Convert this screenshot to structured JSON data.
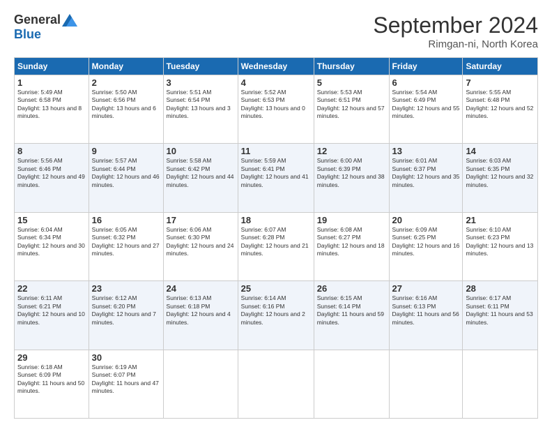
{
  "logo": {
    "general": "General",
    "blue": "Blue"
  },
  "title": "September 2024",
  "location": "Rimgan-ni, North Korea",
  "days_header": [
    "Sunday",
    "Monday",
    "Tuesday",
    "Wednesday",
    "Thursday",
    "Friday",
    "Saturday"
  ],
  "weeks": [
    [
      {
        "day": "1",
        "sunrise": "5:49 AM",
        "sunset": "6:58 PM",
        "daylight": "13 hours and 8 minutes."
      },
      {
        "day": "2",
        "sunrise": "5:50 AM",
        "sunset": "6:56 PM",
        "daylight": "13 hours and 6 minutes."
      },
      {
        "day": "3",
        "sunrise": "5:51 AM",
        "sunset": "6:54 PM",
        "daylight": "13 hours and 3 minutes."
      },
      {
        "day": "4",
        "sunrise": "5:52 AM",
        "sunset": "6:53 PM",
        "daylight": "13 hours and 0 minutes."
      },
      {
        "day": "5",
        "sunrise": "5:53 AM",
        "sunset": "6:51 PM",
        "daylight": "12 hours and 57 minutes."
      },
      {
        "day": "6",
        "sunrise": "5:54 AM",
        "sunset": "6:49 PM",
        "daylight": "12 hours and 55 minutes."
      },
      {
        "day": "7",
        "sunrise": "5:55 AM",
        "sunset": "6:48 PM",
        "daylight": "12 hours and 52 minutes."
      }
    ],
    [
      {
        "day": "8",
        "sunrise": "5:56 AM",
        "sunset": "6:46 PM",
        "daylight": "12 hours and 49 minutes."
      },
      {
        "day": "9",
        "sunrise": "5:57 AM",
        "sunset": "6:44 PM",
        "daylight": "12 hours and 46 minutes."
      },
      {
        "day": "10",
        "sunrise": "5:58 AM",
        "sunset": "6:42 PM",
        "daylight": "12 hours and 44 minutes."
      },
      {
        "day": "11",
        "sunrise": "5:59 AM",
        "sunset": "6:41 PM",
        "daylight": "12 hours and 41 minutes."
      },
      {
        "day": "12",
        "sunrise": "6:00 AM",
        "sunset": "6:39 PM",
        "daylight": "12 hours and 38 minutes."
      },
      {
        "day": "13",
        "sunrise": "6:01 AM",
        "sunset": "6:37 PM",
        "daylight": "12 hours and 35 minutes."
      },
      {
        "day": "14",
        "sunrise": "6:03 AM",
        "sunset": "6:35 PM",
        "daylight": "12 hours and 32 minutes."
      }
    ],
    [
      {
        "day": "15",
        "sunrise": "6:04 AM",
        "sunset": "6:34 PM",
        "daylight": "12 hours and 30 minutes."
      },
      {
        "day": "16",
        "sunrise": "6:05 AM",
        "sunset": "6:32 PM",
        "daylight": "12 hours and 27 minutes."
      },
      {
        "day": "17",
        "sunrise": "6:06 AM",
        "sunset": "6:30 PM",
        "daylight": "12 hours and 24 minutes."
      },
      {
        "day": "18",
        "sunrise": "6:07 AM",
        "sunset": "6:28 PM",
        "daylight": "12 hours and 21 minutes."
      },
      {
        "day": "19",
        "sunrise": "6:08 AM",
        "sunset": "6:27 PM",
        "daylight": "12 hours and 18 minutes."
      },
      {
        "day": "20",
        "sunrise": "6:09 AM",
        "sunset": "6:25 PM",
        "daylight": "12 hours and 16 minutes."
      },
      {
        "day": "21",
        "sunrise": "6:10 AM",
        "sunset": "6:23 PM",
        "daylight": "12 hours and 13 minutes."
      }
    ],
    [
      {
        "day": "22",
        "sunrise": "6:11 AM",
        "sunset": "6:21 PM",
        "daylight": "12 hours and 10 minutes."
      },
      {
        "day": "23",
        "sunrise": "6:12 AM",
        "sunset": "6:20 PM",
        "daylight": "12 hours and 7 minutes."
      },
      {
        "day": "24",
        "sunrise": "6:13 AM",
        "sunset": "6:18 PM",
        "daylight": "12 hours and 4 minutes."
      },
      {
        "day": "25",
        "sunrise": "6:14 AM",
        "sunset": "6:16 PM",
        "daylight": "12 hours and 2 minutes."
      },
      {
        "day": "26",
        "sunrise": "6:15 AM",
        "sunset": "6:14 PM",
        "daylight": "11 hours and 59 minutes."
      },
      {
        "day": "27",
        "sunrise": "6:16 AM",
        "sunset": "6:13 PM",
        "daylight": "11 hours and 56 minutes."
      },
      {
        "day": "28",
        "sunrise": "6:17 AM",
        "sunset": "6:11 PM",
        "daylight": "11 hours and 53 minutes."
      }
    ],
    [
      {
        "day": "29",
        "sunrise": "6:18 AM",
        "sunset": "6:09 PM",
        "daylight": "11 hours and 50 minutes."
      },
      {
        "day": "30",
        "sunrise": "6:19 AM",
        "sunset": "6:07 PM",
        "daylight": "11 hours and 47 minutes."
      },
      null,
      null,
      null,
      null,
      null
    ]
  ]
}
